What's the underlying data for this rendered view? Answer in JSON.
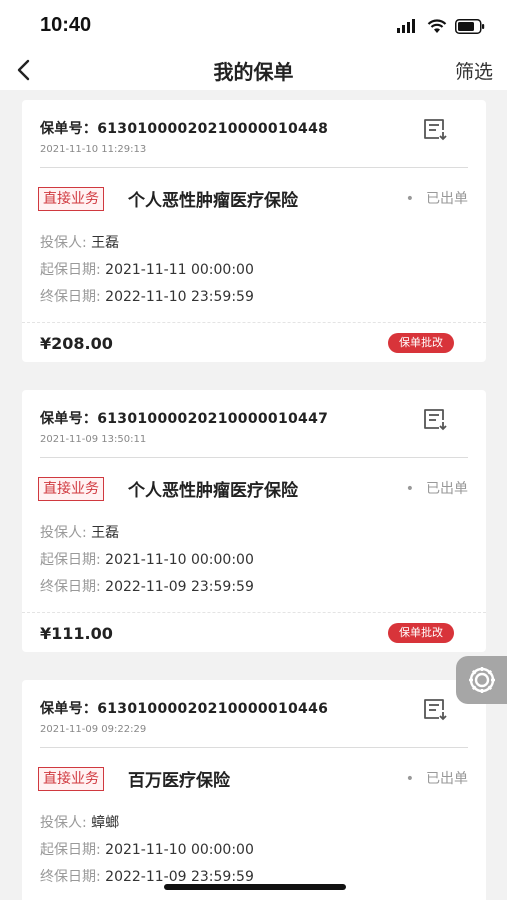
{
  "status_bar": {
    "time": "10:40"
  },
  "nav": {
    "title": "我的保单",
    "filter_label": "筛选"
  },
  "policies": [
    {
      "policy_no_label": "保单号：",
      "policy_no": "61301000020210000010448",
      "created_time": "2021-11-10 11:29:13",
      "biz_tag": "直接业务",
      "product_name": "个人恶性肿瘤医疗保险",
      "status": "已出单",
      "holder_label": "投保人: ",
      "holder": "王磊",
      "start_label": "起保日期: ",
      "start_date": "2021-11-11 00:00:00",
      "end_label": "终保日期: ",
      "end_date": "2022-11-10 23:59:59",
      "premium": "¥208.00",
      "action_label": "保单批改"
    },
    {
      "policy_no_label": "保单号：",
      "policy_no": "61301000020210000010447",
      "created_time": "2021-11-09 13:50:11",
      "biz_tag": "直接业务",
      "product_name": "个人恶性肿瘤医疗保险",
      "status": "已出单",
      "holder_label": "投保人: ",
      "holder": "王磊",
      "start_label": "起保日期: ",
      "start_date": "2021-11-10 00:00:00",
      "end_label": "终保日期: ",
      "end_date": "2022-11-09 23:59:59",
      "premium": "¥111.00",
      "action_label": "保单批改"
    },
    {
      "policy_no_label": "保单号：",
      "policy_no": "61301000020210000010446",
      "created_time": "2021-11-09 09:22:29",
      "biz_tag": "直接业务",
      "product_name": "百万医疗保险",
      "status": "已出单",
      "holder_label": "投保人: ",
      "holder": "蟑螂",
      "start_label": "起保日期: ",
      "start_date": "2021-11-10 00:00:00",
      "end_label": "终保日期: ",
      "end_date": "2022-11-09 23:59:59"
    }
  ],
  "icons": {
    "back": "chevron-left-icon",
    "signal": "signal-icon",
    "wifi": "wifi-icon",
    "battery": "battery-icon",
    "document": "document-download-icon",
    "floating": "gear-icon"
  },
  "colors": {
    "accent": "#d8343a",
    "tag_border": "#d0393f"
  }
}
